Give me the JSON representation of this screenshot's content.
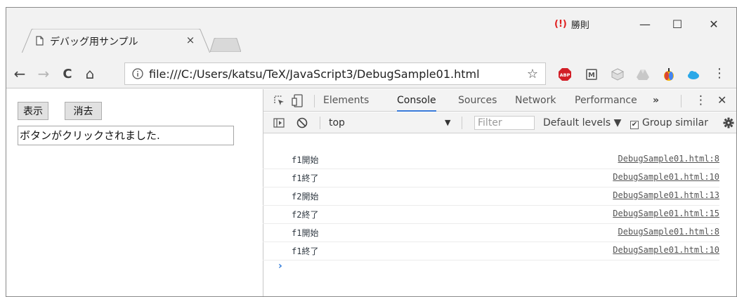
{
  "tab": {
    "title": "デバッグ用サンプル",
    "close": "×"
  },
  "user": {
    "name": "勝則",
    "alert": "(!)"
  },
  "window_controls": {
    "minimize": "—",
    "maximize": "☐",
    "close": "✕"
  },
  "nav": {
    "back": "←",
    "forward": "→",
    "reload": "C",
    "home": "⌂"
  },
  "omnibox": {
    "url": "file:///C:/Users/katsu/TeX/JavaScript3/DebugSample01.html",
    "star": "☆"
  },
  "menu": {
    "dots": "⋮"
  },
  "page": {
    "show_button": "表示",
    "clear_button": "消去",
    "output_text": "ボタンがクリックされました."
  },
  "devtools": {
    "tabs": [
      "Elements",
      "Console",
      "Sources",
      "Network",
      "Performance"
    ],
    "active_tab": "Console",
    "more": "»",
    "kebab": "⋮",
    "close": "✕",
    "context": "top",
    "context_arrow": "▼",
    "filter_placeholder": "Filter",
    "levels": "Default levels ▼",
    "group_similar": "Group similar",
    "group_checked": "✔",
    "prompt": "›",
    "logs": [
      {
        "msg": "f1開始",
        "src": "DebugSample01.html:8"
      },
      {
        "msg": "f1終了",
        "src": "DebugSample01.html:10"
      },
      {
        "msg": "f2開始",
        "src": "DebugSample01.html:13"
      },
      {
        "msg": "f2終了",
        "src": "DebugSample01.html:15"
      },
      {
        "msg": "f1開始",
        "src": "DebugSample01.html:8"
      },
      {
        "msg": "f1終了",
        "src": "DebugSample01.html:10"
      }
    ]
  },
  "colors": {
    "accent": "#3879d9",
    "alert": "#e02020",
    "abp": "#d21f27"
  }
}
